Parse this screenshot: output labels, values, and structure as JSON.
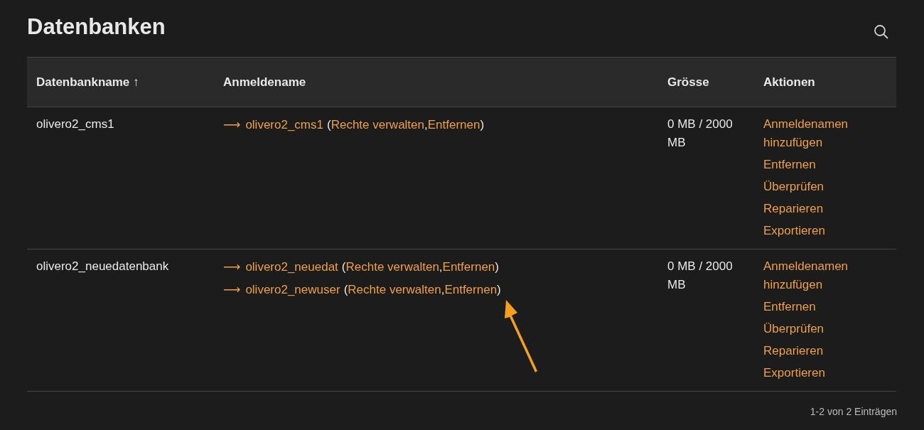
{
  "title": "Datenbanken",
  "table": {
    "columns": [
      {
        "label": "Datenbankname ↑"
      },
      {
        "label": "Anmeldename"
      },
      {
        "label": "Grösse"
      },
      {
        "label": "Aktionen"
      }
    ],
    "rows": [
      {
        "name": "olivero2_cms1",
        "logins": [
          {
            "arrow": "⟶",
            "name": "olivero2_cms1",
            "open": "(",
            "actions": [
              "Rechte verwalten",
              "Entfernen"
            ],
            "separator": ",",
            "close": ")"
          }
        ],
        "size": "0 MB / 2000 MB",
        "actions": [
          "Anmeldenamen hinzufügen",
          "Entfernen",
          "Überprüfen",
          "Reparieren",
          "Exportieren"
        ]
      },
      {
        "name": "olivero2_neuedatenbank",
        "logins": [
          {
            "arrow": "⟶",
            "name": "olivero2_neuedat",
            "open": "(",
            "actions": [
              "Rechte verwalten",
              "Entfernen"
            ],
            "separator": ",",
            "close": ")"
          },
          {
            "arrow": "⟶",
            "name": "olivero2_newuser",
            "open": "(",
            "actions": [
              "Rechte verwalten",
              "Entfernen"
            ],
            "separator": ",",
            "close": ")"
          }
        ],
        "size": "0 MB / 2000 MB",
        "actions": [
          "Anmeldenamen hinzufügen",
          "Entfernen",
          "Überprüfen",
          "Reparieren",
          "Exportieren"
        ]
      }
    ]
  },
  "footer": "1-2 von 2 Einträgen"
}
